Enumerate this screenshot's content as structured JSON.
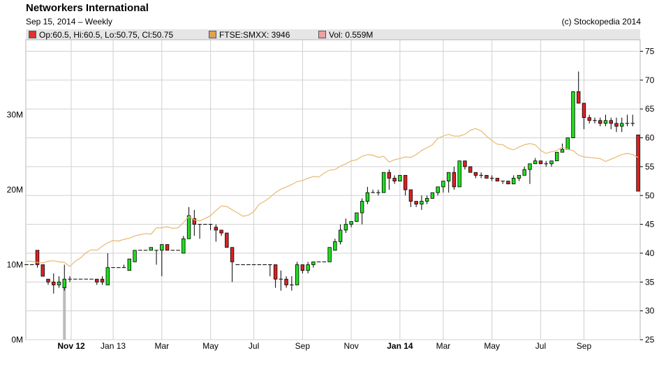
{
  "header": {
    "title": "Networkers International",
    "subtitle": "Sep 15, 2014  –  Weekly",
    "copyright": "(c) Stockopedia 2014"
  },
  "legend": [
    {
      "label": "Op:60.5, Hi:60.5, Lo:50.75, Cl:50.75",
      "color": "#e03030"
    },
    {
      "label": "FTSE:SMXX: 3946",
      "color": "#e0a050"
    },
    {
      "label": "Vol: 0.559M",
      "color": "#f0a0a0"
    }
  ],
  "colors": {
    "up": "#22dd22",
    "down": "#dd2222",
    "ftse": "#e8b870",
    "grid": "#d0d0d0",
    "volume_spike": "#bbbbbb"
  },
  "chart_data": {
    "type": "candlestick",
    "x_tick_labels": [
      "Nov 12",
      "Jan 13",
      "Mar",
      "May",
      "Jul",
      "Sep",
      "Nov",
      "Jan 14",
      "Mar",
      "May",
      "Jul",
      "Sep"
    ],
    "price_axis": {
      "side": "right",
      "ylim": [
        25,
        77
      ],
      "ticks": [
        25,
        30,
        35,
        40,
        45,
        50,
        55,
        60,
        65,
        70,
        75
      ]
    },
    "volume_axis": {
      "side": "left",
      "ylim": [
        0,
        40
      ],
      "unit": "M",
      "ticks": [
        "0M",
        "10M",
        "20M",
        "30M"
      ]
    },
    "grid": true,
    "candles": [
      [
        38.0,
        38.0,
        38.0,
        38.0
      ],
      [
        38.0,
        38.0,
        38.0,
        38.0
      ],
      [
        40.5,
        40.5,
        37.5,
        38.0
      ],
      [
        38.0,
        38.0,
        36.0,
        36.0
      ],
      [
        35.5,
        35.5,
        34.5,
        35.0
      ],
      [
        35.0,
        36.5,
        33.0,
        34.5
      ],
      [
        34.5,
        36.0,
        34.0,
        35.0
      ],
      [
        34.0,
        38.0,
        33.5,
        35.5
      ],
      [
        35.5,
        36.0,
        35.0,
        35.5
      ],
      [
        35.5,
        35.5,
        35.5,
        35.5
      ],
      [
        35.5,
        35.5,
        35.5,
        35.5
      ],
      [
        35.5,
        35.5,
        35.5,
        35.5
      ],
      [
        35.5,
        35.5,
        35.5,
        35.5
      ],
      [
        35.5,
        35.5,
        34.5,
        35.0
      ],
      [
        35.5,
        36.0,
        34.5,
        35.0
      ],
      [
        34.5,
        40.0,
        34.5,
        37.5
      ],
      [
        37.5,
        37.5,
        37.5,
        37.5
      ],
      [
        37.5,
        37.5,
        37.5,
        37.5
      ],
      [
        37.5,
        38.0,
        37.5,
        37.5
      ],
      [
        37.0,
        39.0,
        37.0,
        39.0
      ],
      [
        38.5,
        40.5,
        38.5,
        40.5
      ],
      [
        40.5,
        40.5,
        40.5,
        40.5
      ],
      [
        40.5,
        40.5,
        40.5,
        40.5
      ],
      [
        40.5,
        41.0,
        40.5,
        41.0
      ],
      [
        40.5,
        40.5,
        38.0,
        40.5
      ],
      [
        40.5,
        41.5,
        36.0,
        41.5
      ],
      [
        41.5,
        41.5,
        40.5,
        40.5
      ],
      [
        40.5,
        40.5,
        40.5,
        40.5
      ],
      [
        40.5,
        40.5,
        40.5,
        40.5
      ],
      [
        40.0,
        43.0,
        40.0,
        42.5
      ],
      [
        42.5,
        48.0,
        42.5,
        46.5
      ],
      [
        46.0,
        47.5,
        43.0,
        45.0
      ],
      [
        45.0,
        45.0,
        42.5,
        45.0
      ],
      [
        45.0,
        45.0,
        45.0,
        45.0
      ],
      [
        45.0,
        45.0,
        44.0,
        45.0
      ],
      [
        44.5,
        45.0,
        42.0,
        44.0
      ],
      [
        44.0,
        44.0,
        43.0,
        43.5
      ],
      [
        43.5,
        43.5,
        41.5,
        41.0
      ],
      [
        41.0,
        41.0,
        35.0,
        38.5
      ],
      [
        38.0,
        38.0,
        38.0,
        38.0
      ],
      [
        38.0,
        38.0,
        38.0,
        38.0
      ],
      [
        38.0,
        38.0,
        38.0,
        38.0
      ],
      [
        38.0,
        38.0,
        38.0,
        38.0
      ],
      [
        38.0,
        38.0,
        38.0,
        38.0
      ],
      [
        38.0,
        38.0,
        38.0,
        38.0
      ],
      [
        38.0,
        38.0,
        36.0,
        38.0
      ],
      [
        38.0,
        38.0,
        34.0,
        35.5
      ],
      [
        35.5,
        37.0,
        33.5,
        35.5
      ],
      [
        35.5,
        36.0,
        34.0,
        34.5
      ],
      [
        34.5,
        36.0,
        33.5,
        34.5
      ],
      [
        34.5,
        38.5,
        34.5,
        38.0
      ],
      [
        38.0,
        38.0,
        36.5,
        37.0
      ],
      [
        37.0,
        38.5,
        36.5,
        38.0
      ],
      [
        38.0,
        38.5,
        37.5,
        38.5
      ],
      [
        38.5,
        38.5,
        38.5,
        38.5
      ],
      [
        38.5,
        38.5,
        38.5,
        38.5
      ],
      [
        38.5,
        41.0,
        38.5,
        41.0
      ],
      [
        40.5,
        42.5,
        40.5,
        42.0
      ],
      [
        42.0,
        45.0,
        41.5,
        44.0
      ],
      [
        44.0,
        46.0,
        43.5,
        45.0
      ],
      [
        45.0,
        45.5,
        44.5,
        45.5
      ],
      [
        45.5,
        47.0,
        45.5,
        47.0
      ],
      [
        47.0,
        49.5,
        45.0,
        49.0
      ],
      [
        49.0,
        51.5,
        48.5,
        50.5
      ],
      [
        50.5,
        51.0,
        50.5,
        50.5
      ],
      [
        50.5,
        51.0,
        50.0,
        50.5
      ],
      [
        50.5,
        54.0,
        50.5,
        54.0
      ],
      [
        54.0,
        54.5,
        51.0,
        53.0
      ],
      [
        53.0,
        53.5,
        52.0,
        52.5
      ],
      [
        52.5,
        53.5,
        52.5,
        53.5
      ],
      [
        53.5,
        53.5,
        50.0,
        51.0
      ],
      [
        51.0,
        51.0,
        48.0,
        49.0
      ],
      [
        49.0,
        49.0,
        48.0,
        48.5
      ],
      [
        48.5,
        50.0,
        47.5,
        49.0
      ],
      [
        49.0,
        50.0,
        48.5,
        49.5
      ],
      [
        49.5,
        50.5,
        49.5,
        50.5
      ],
      [
        50.5,
        51.5,
        50.0,
        51.5
      ],
      [
        51.5,
        52.0,
        50.5,
        52.5
      ],
      [
        52.5,
        54.0,
        50.5,
        54.0
      ],
      [
        54.0,
        55.0,
        51.0,
        51.5
      ],
      [
        51.5,
        56.0,
        51.5,
        56.0
      ],
      [
        56.0,
        56.0,
        54.5,
        55.0
      ],
      [
        55.0,
        55.0,
        54.0,
        54.0
      ],
      [
        54.0,
        54.0,
        53.0,
        53.5
      ],
      [
        53.5,
        54.0,
        53.0,
        53.5
      ],
      [
        53.5,
        53.5,
        53.0,
        53.0
      ],
      [
        53.0,
        53.5,
        52.5,
        53.0
      ],
      [
        53.0,
        53.0,
        52.5,
        52.5
      ],
      [
        52.5,
        52.5,
        52.0,
        52.5
      ],
      [
        52.5,
        52.5,
        52.0,
        52.0
      ],
      [
        52.0,
        53.5,
        52.0,
        53.0
      ],
      [
        53.0,
        53.5,
        52.5,
        53.5
      ],
      [
        53.5,
        55.0,
        53.5,
        54.5
      ],
      [
        54.5,
        55.5,
        52.0,
        55.5
      ],
      [
        55.5,
        56.5,
        55.5,
        56.0
      ],
      [
        56.0,
        56.0,
        55.5,
        55.5
      ],
      [
        55.5,
        56.0,
        55.0,
        55.5
      ],
      [
        55.5,
        56.0,
        55.0,
        56.0
      ],
      [
        56.0,
        57.5,
        56.0,
        57.5
      ],
      [
        57.5,
        59.0,
        57.5,
        58.0
      ],
      [
        58.0,
        60.0,
        58.0,
        60.0
      ],
      [
        60.0,
        68.0,
        60.0,
        68.0
      ],
      [
        68.0,
        71.5,
        66.0,
        66.0
      ],
      [
        66.0,
        66.0,
        61.5,
        63.5
      ],
      [
        63.5,
        64.0,
        62.5,
        63.0
      ],
      [
        63.0,
        63.5,
        62.5,
        63.0
      ],
      [
        63.0,
        63.5,
        62.0,
        62.5
      ],
      [
        62.5,
        64.0,
        62.0,
        63.0
      ],
      [
        63.0,
        63.5,
        61.5,
        62.5
      ],
      [
        62.5,
        63.5,
        61.0,
        62.0
      ],
      [
        62.0,
        63.5,
        61.0,
        62.5
      ],
      [
        62.5,
        64.0,
        62.0,
        62.5
      ],
      [
        62.5,
        64.0,
        62.0,
        62.5
      ],
      [
        60.5,
        60.5,
        50.75,
        50.75
      ]
    ],
    "ftse_scaled": [
      38.6,
      38.6,
      38.4,
      38.3,
      38.6,
      38.7,
      38.5,
      38.4,
      37.7,
      38.6,
      39.2,
      40.1,
      40.6,
      40.5,
      41.2,
      41.8,
      42.2,
      42.1,
      42.4,
      42.6,
      43.0,
      43.2,
      43.4,
      43.3,
      44.4,
      44.4,
      44.6,
      44.3,
      44.4,
      45.3,
      46.4,
      45.8,
      45.6,
      46.0,
      46.5,
      47.4,
      48.2,
      48.1,
      47.5,
      47.0,
      46.4,
      46.6,
      47.2,
      48.5,
      49.0,
      49.7,
      50.5,
      51.1,
      51.5,
      51.9,
      52.4,
      52.6,
      53.0,
      53.3,
      53.2,
      53.9,
      54.4,
      54.5,
      55.1,
      55.5,
      56.0,
      56.2,
      56.8,
      57.1,
      57.0,
      56.6,
      56.8,
      55.8,
      56.2,
      56.4,
      56.7,
      56.6,
      57.1,
      57.8,
      58.3,
      58.8,
      59.9,
      60.3,
      60.6,
      60.3,
      60.3,
      60.6,
      61.3,
      61.6,
      61.2,
      60.3,
      59.5,
      58.9,
      58.8,
      58.2,
      57.9,
      58.4,
      58.8,
      59.0,
      58.8,
      57.8,
      57.3,
      57.6,
      57.8,
      58.4,
      58.0,
      57.8,
      57.0,
      56.7,
      56.6,
      56.5,
      56.4,
      55.9,
      56.3,
      56.7,
      57.1,
      57.3,
      57.1,
      56.6
    ],
    "volume_spike": {
      "index": 7,
      "value": 7.5
    }
  }
}
